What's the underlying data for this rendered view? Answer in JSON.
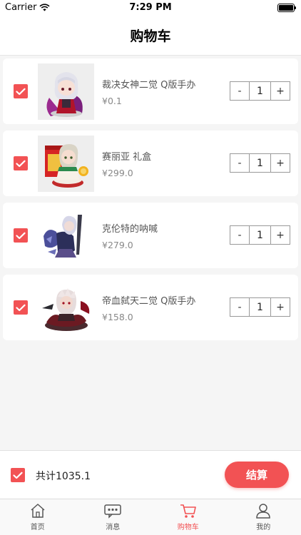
{
  "status_bar": {
    "carrier": "Carrier",
    "time": "7:29 PM"
  },
  "nav": {
    "title": "购物车"
  },
  "cart_items": [
    {
      "name": "裁决女神二觉 Q版手办",
      "price": "¥0.1",
      "quantity": "1",
      "checked": true
    },
    {
      "name": "赛丽亚 礼盒",
      "price": "¥299.0",
      "quantity": "1",
      "checked": true
    },
    {
      "name": "克伦特的呐喊",
      "price": "¥279.0",
      "quantity": "1",
      "checked": true
    },
    {
      "name": "帝血弑天二觉 Q版手办",
      "price": "¥158.0",
      "quantity": "1",
      "checked": true
    }
  ],
  "stepper": {
    "minus": "-",
    "plus": "+"
  },
  "footer": {
    "total_label": "共计1035.1",
    "checkout_label": "结算",
    "select_all_checked": true
  },
  "tabs": [
    {
      "label": "首页",
      "icon": "home-icon",
      "active": false
    },
    {
      "label": "消息",
      "icon": "message-icon",
      "active": false
    },
    {
      "label": "购物车",
      "icon": "cart-icon",
      "active": true
    },
    {
      "label": "我的",
      "icon": "profile-icon",
      "active": false
    }
  ],
  "colors": {
    "accent": "#f25254",
    "active_tab": "#f25254"
  }
}
